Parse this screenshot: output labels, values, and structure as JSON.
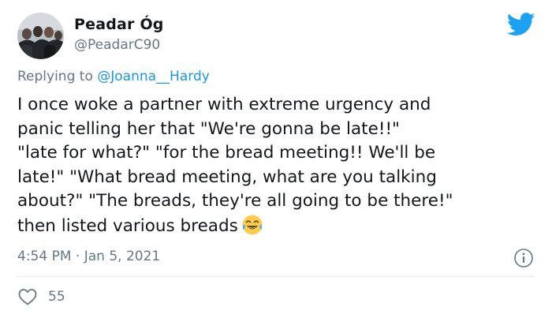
{
  "author": {
    "display_name": "Peadar Óg",
    "handle": "@PeadarC90",
    "avatar_icon": "profile-photo-icon"
  },
  "platform": {
    "logo_icon": "twitter-bird-icon",
    "brand_color": "#1da1f2"
  },
  "reply": {
    "prefix": "Replying to ",
    "mention": "@Joanna__Hardy"
  },
  "tweet": {
    "lines": [
      "I once woke a partner with extreme urgency and",
      "panic telling her that \"We're gonna be late!!\"",
      "\"late for what?\" \"for the bread meeting!! We'll be",
      "late!\" \"What bread meeting, what are you talking",
      "about?\" \"The breads, they're all going to be there!\"",
      "then listed various breads"
    ],
    "emoji_icon": "face-with-tears-of-joy-icon"
  },
  "meta": {
    "timestamp": "4:54 PM · Jan 5, 2021",
    "info_icon": "info-icon"
  },
  "engagement": {
    "like_icon": "heart-icon",
    "like_count": "55"
  },
  "colors": {
    "text": "#14171a",
    "secondary": "#657786",
    "link": "#1b95e0",
    "divider": "#e1e8ed"
  }
}
